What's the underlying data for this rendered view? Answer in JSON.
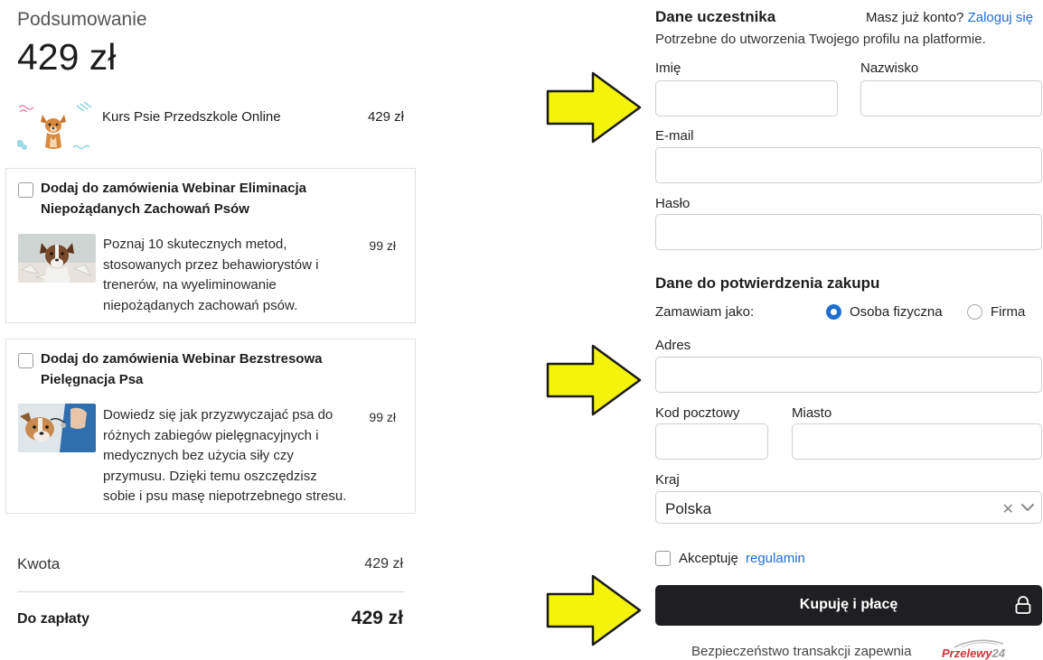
{
  "summary": {
    "title": "Podsumowanie",
    "total": "429 zł"
  },
  "product": {
    "name": "Kurs Psie Przedszkole Online",
    "price": "429 zł"
  },
  "addons": [
    {
      "title": "Dodaj do zamówienia Webinar Eliminacja Niepożądanych Zachowań Psów",
      "description": "Poznaj 10 skutecznych metod, stosowanych przez behawiorystów i trenerów, na wyeliminowanie niepożądanych zachowań psów.",
      "price": "99 zł",
      "checked": false
    },
    {
      "title": "Dodaj do zamówienia Webinar Bezstresowa Pielęgnacja Psa",
      "description": "Dowiedz się jak przyzwyczajać psa do różnych zabiegów pielęgnacyjnych i medycznych bez użycia siły czy przymusu. Dzięki temu oszczędzisz sobie i psu masę niepotrzebnego stresu.",
      "price": "99 zł",
      "checked": false
    }
  ],
  "totals": {
    "amount_label": "Kwota",
    "amount_value": "429 zł",
    "pay_label": "Do zapłaty",
    "pay_value": "429 zł"
  },
  "participant": {
    "title": "Dane uczestnika",
    "have_account": "Masz już konto?",
    "login_link": "Zaloguj się",
    "subtitle": "Potrzebne do utworzenia Twojego profilu na platformie.",
    "first_name_label": "Imię",
    "first_name_value": "",
    "last_name_label": "Nazwisko",
    "last_name_value": "",
    "email_label": "E-mail",
    "email_value": "",
    "password_label": "Hasło",
    "password_value": ""
  },
  "purchase": {
    "title": "Dane do potwierdzenia zakupu",
    "order_as_label": "Zamawiam jako:",
    "option_person": "Osoba fizyczna",
    "option_company": "Firma",
    "selected": "Osoba fizyczna",
    "address_label": "Adres",
    "address_value": "",
    "postal_label": "Kod pocztowy",
    "postal_value": "",
    "city_label": "Miasto",
    "city_value": "",
    "country_label": "Kraj",
    "country_value": "Polska"
  },
  "accept": {
    "text": "Akceptuję",
    "link": "regulamin",
    "checked": false
  },
  "buy_button": {
    "label": "Kupuję i płacę"
  },
  "security": {
    "text": "Bezpieczeństwo transakcji zapewnia",
    "provider_a": "Przelewy",
    "provider_b": "24"
  },
  "colors": {
    "accent": "#1e6fd0",
    "button_bg": "#1f1f21",
    "arrow_fill": "#f4f30a",
    "p24_red": "#d13239"
  },
  "icons": [
    "dog-illustration",
    "dog-photo",
    "vet-dog-photo",
    "arrow-icon",
    "close-icon",
    "chevron-down-icon",
    "lock-icon",
    "przelewy24-logo"
  ]
}
